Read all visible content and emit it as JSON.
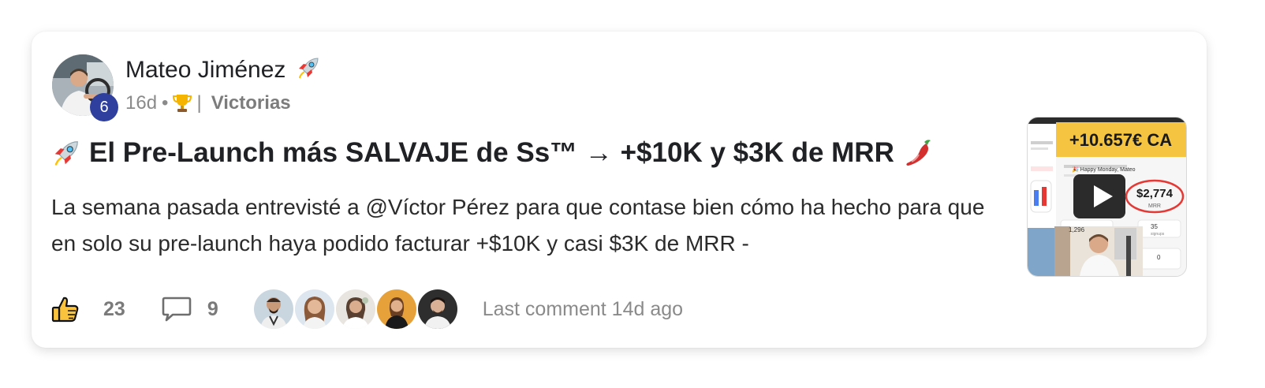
{
  "post": {
    "author": {
      "name": "Mateo Jiménez",
      "name_emoji": "rocket-emoji",
      "level": "6"
    },
    "meta": {
      "time": "16d",
      "dot": "•",
      "badge_icon": "trophy-emoji",
      "separator": "|",
      "category": "Victorias"
    },
    "title": {
      "lead_emoji": "rocket-emoji",
      "text": "El Pre-Launch más SALVAJE de Ss™ → +$10K y $3K de MRR",
      "trail_emoji": "chili-pepper-emoji"
    },
    "body": "La semana pasada entrevisté a @Víctor Pérez para que contase bien cómo ha hecho para que en solo su pre-launch haya podido facturar +$10K y casi $3K de MRR -",
    "thumbnail": {
      "banner": "+10.657€ CA",
      "mrr_value": "$2,774",
      "mrr_label": "MRR",
      "greeting": "🎉 Happy Monday, Mateo",
      "stat_1": "1,296",
      "stat_2": "35",
      "stat_3": "0",
      "stat_2_label": "signups",
      "play_icon": "play-icon"
    },
    "footer": {
      "likes": "23",
      "comments": "9",
      "like_icon": "thumbs-up-icon",
      "comment_icon": "comment-bubble-icon",
      "last_comment": "Last comment 14d ago",
      "commenter_count": 5
    }
  }
}
